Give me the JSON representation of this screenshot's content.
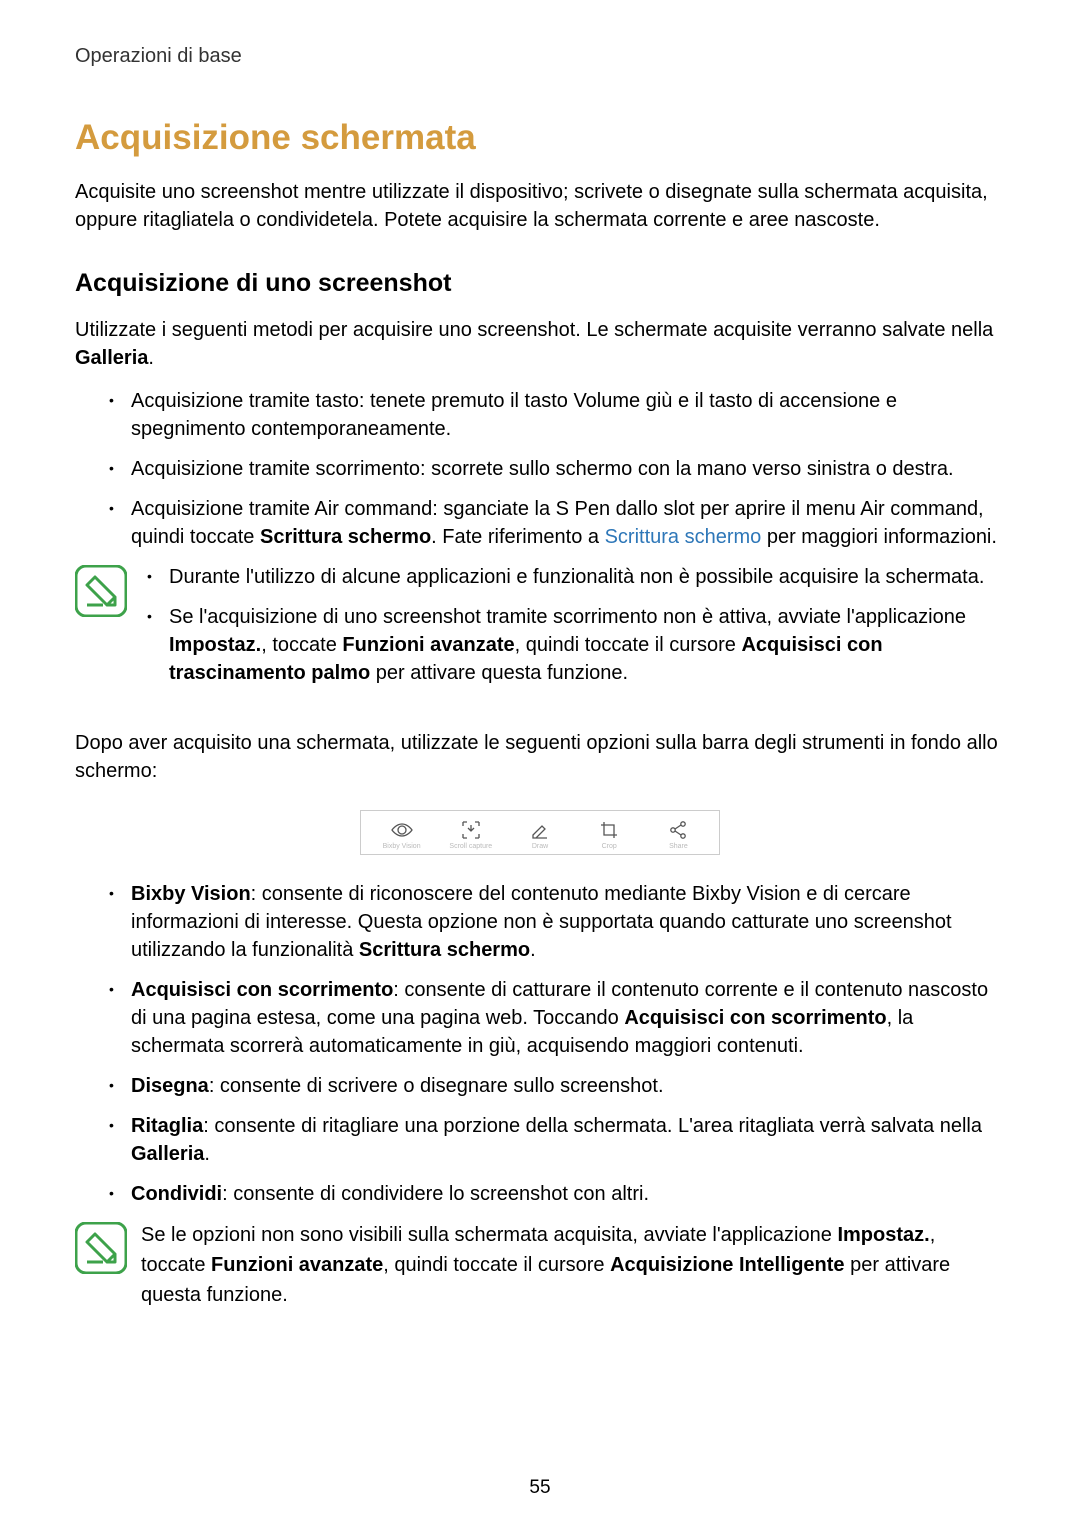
{
  "header": {
    "breadcrumb": "Operazioni di base"
  },
  "title": "Acquisizione schermata",
  "intro": "Acquisite uno screenshot mentre utilizzate il dispositivo; scrivete o disegnate sulla schermata acquisita, oppure ritagliatela o condividetela. Potete acquisire la schermata corrente e aree nascoste.",
  "section1": {
    "title": "Acquisizione di uno screenshot",
    "lead_pre": "Utilizzate i seguenti metodi per acquisire uno screenshot. Le schermate acquisite verranno salvate nella ",
    "lead_bold": "Galleria",
    "lead_post": ".",
    "item1": "Acquisizione tramite tasto: tenete premuto il tasto Volume giù e il tasto di accensione e spegnimento contemporaneamente.",
    "item2": "Acquisizione tramite scorrimento: scorrete sullo schermo con la mano verso sinistra o destra.",
    "item3_a": "Acquisizione tramite Air command: sganciate la S Pen dallo slot per aprire il menu Air command, quindi toccate ",
    "item3_b": "Scrittura schermo",
    "item3_c": ". Fate riferimento a ",
    "item3_link": "Scrittura schermo",
    "item3_d": " per maggiori informazioni."
  },
  "note1": {
    "item1": "Durante l'utilizzo di alcune applicazioni e funzionalità non è possibile acquisire la schermata.",
    "item2_a": "Se l'acquisizione di uno screenshot tramite scorrimento non è attiva, avviate l'applicazione ",
    "item2_b": "Impostaz.",
    "item2_c": ", toccate ",
    "item2_d": "Funzioni avanzate",
    "item2_e": ", quindi toccate il cursore ",
    "item2_f": "Acquisisci con trascinamento palmo",
    "item2_g": " per attivare questa funzione."
  },
  "after_note": "Dopo aver acquisito una schermata, utilizzate le seguenti opzioni sulla barra degli strumenti in fondo allo schermo:",
  "toolbar": {
    "items": [
      {
        "label": "Bixby Vision"
      },
      {
        "label": "Scroll capture"
      },
      {
        "label": "Draw"
      },
      {
        "label": "Crop"
      },
      {
        "label": "Share"
      }
    ]
  },
  "options": {
    "bixby_b": "Bixby Vision",
    "bixby_t1": ": consente di riconoscere del contenuto mediante Bixby Vision e di cercare informazioni di interesse. Questa opzione non è supportata quando catturate uno screenshot utilizzando la funzionalità ",
    "bixby_b2": "Scrittura schermo",
    "bixby_t2": ".",
    "scroll_b": "Acquisisci con scorrimento",
    "scroll_t1": ": consente di catturare il contenuto corrente e il contenuto nascosto di una pagina estesa, come una pagina web. Toccando ",
    "scroll_b2": "Acquisisci con scorrimento",
    "scroll_t2": ", la schermata scorrerà automaticamente in giù, acquisendo maggiori contenuti.",
    "draw_b": "Disegna",
    "draw_t": ": consente di scrivere o disegnare sullo screenshot.",
    "crop_b": "Ritaglia",
    "crop_t1": ": consente di ritagliare una porzione della schermata. L'area ritagliata verrà salvata nella ",
    "crop_b2": "Galleria",
    "crop_t2": ".",
    "share_b": "Condividi",
    "share_t": ": consente di condividere lo screenshot con altri."
  },
  "note2": {
    "t1": "Se le opzioni non sono visibili sulla schermata acquisita, avviate l'applicazione ",
    "b1": "Impostaz.",
    "t2": ", toccate ",
    "b2": "Funzioni avanzate",
    "t3": ", quindi toccate il cursore ",
    "b3": "Acquisizione Intelligente",
    "t4": " per attivare questa funzione."
  },
  "page_number": "55"
}
